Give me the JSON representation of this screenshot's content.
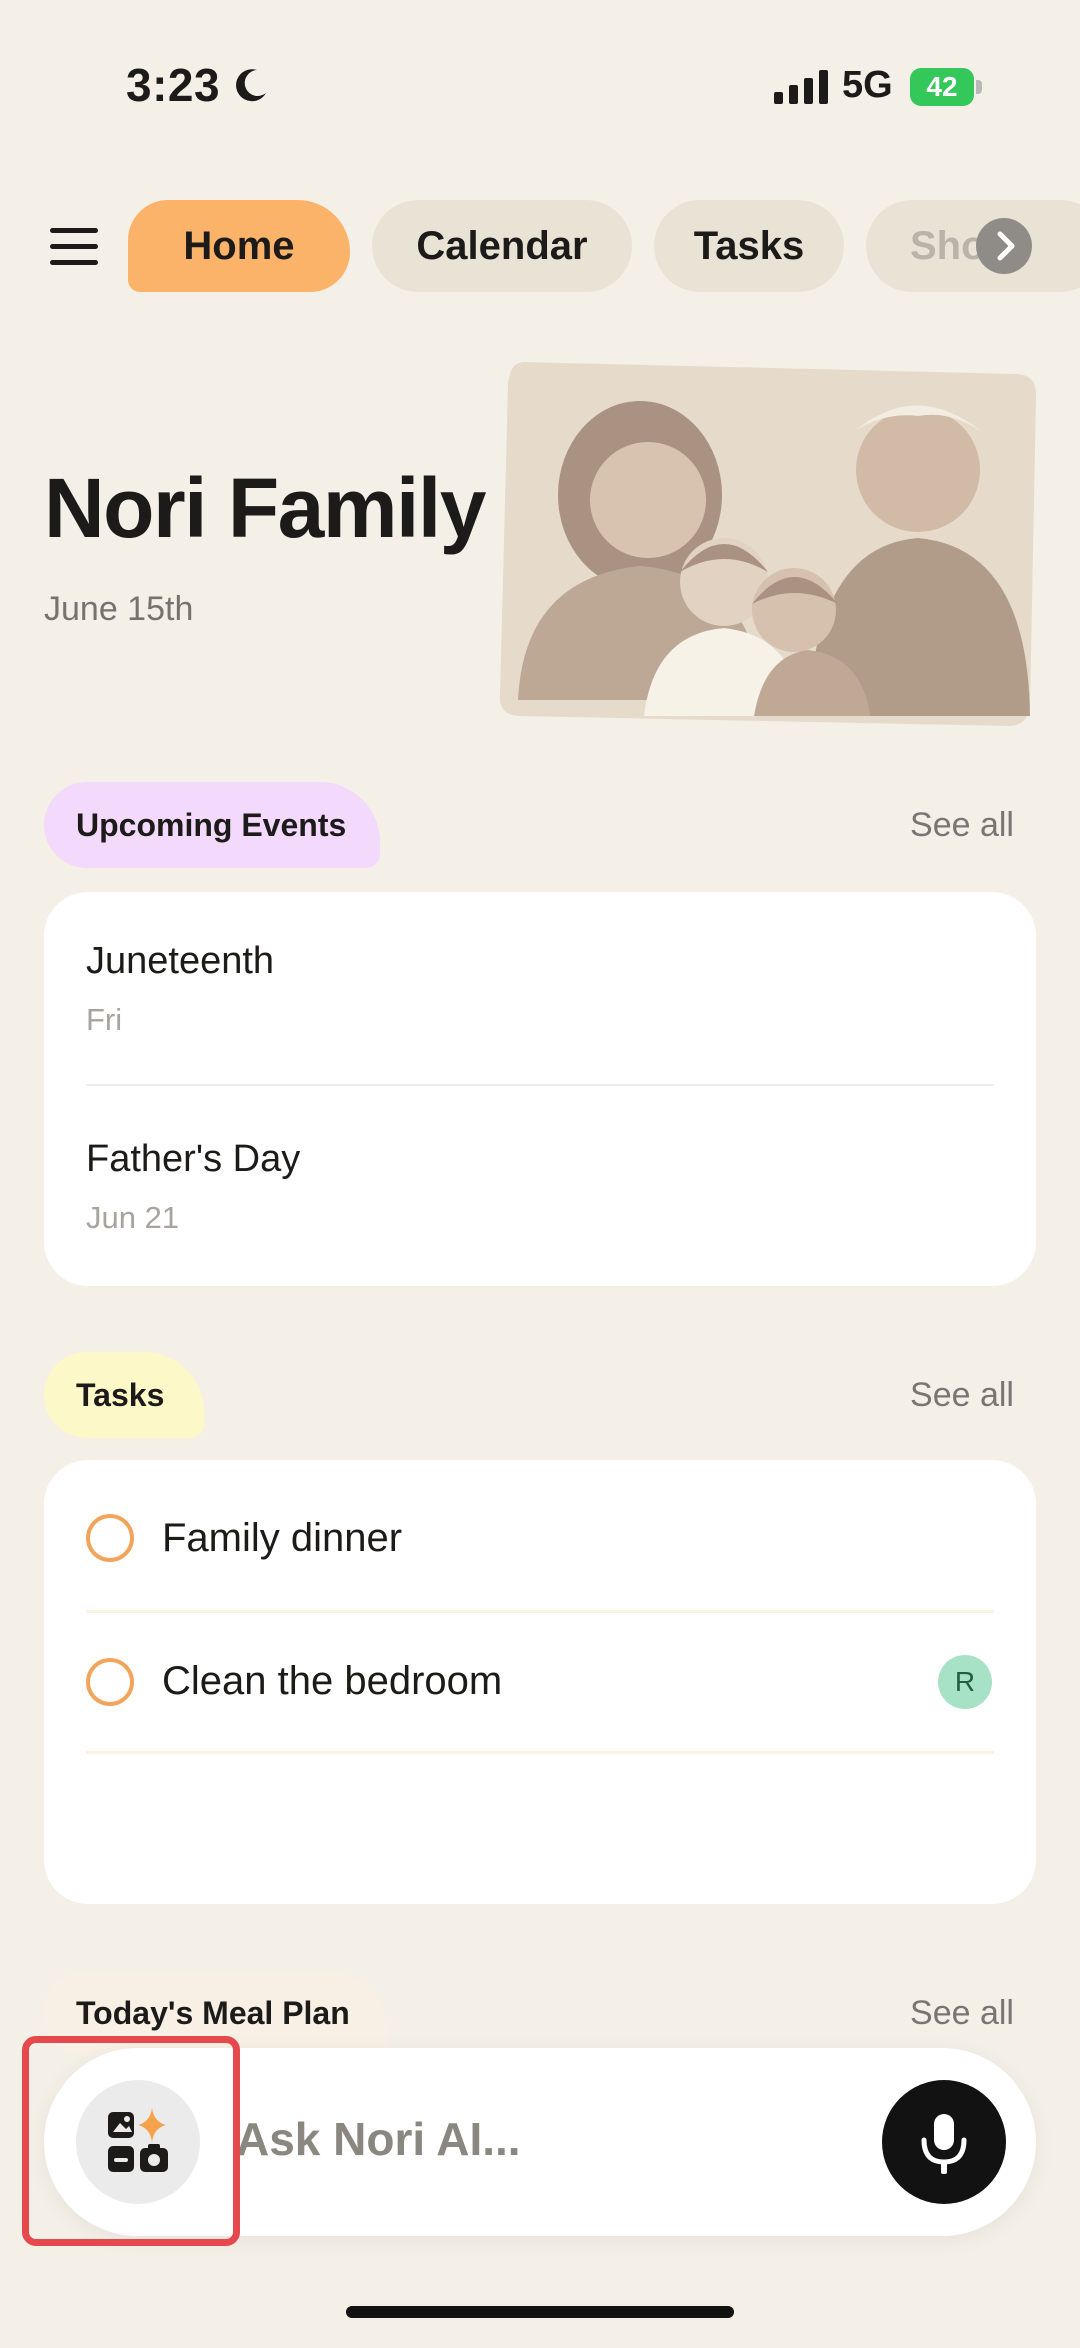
{
  "status_bar": {
    "time": "3:23",
    "network": "5G",
    "battery": "42",
    "battery_color": "#34c759",
    "icons": [
      "moon-icon",
      "signal-icon",
      "battery-charging-icon"
    ]
  },
  "nav": {
    "menu_icon": "hamburger-menu-icon",
    "tabs": [
      {
        "label": "Home",
        "active": true
      },
      {
        "label": "Calendar",
        "active": false
      },
      {
        "label": "Tasks",
        "active": false
      },
      {
        "label": "Sho",
        "active": false
      }
    ],
    "next_icon": "chevron-right-icon"
  },
  "hero": {
    "title": "Nori Family",
    "date": "June 15th",
    "illustration": "family-illustration"
  },
  "upcoming_events": {
    "label": "Upcoming Events",
    "see_all": "See all",
    "items": [
      {
        "title": "Juneteenth",
        "subtitle": "Fri"
      },
      {
        "title": "Father's Day",
        "subtitle": "Jun 21"
      }
    ]
  },
  "tasks": {
    "label": "Tasks",
    "see_all": "See all",
    "items": [
      {
        "title": "Family dinner",
        "assignee": ""
      },
      {
        "title": "Clean the bedroom",
        "assignee": "R"
      }
    ]
  },
  "meal_plan": {
    "label": "Today's Meal Plan",
    "see_all": "See all"
  },
  "composer": {
    "placeholder": "Ask Nori AI...",
    "widget_icon": "widgets-sparkle-icon",
    "mic_icon": "microphone-icon"
  },
  "colors": {
    "background": "#f4f0e8",
    "accent_orange": "#fbb36a",
    "events_pill": "#f3d9fb",
    "tasks_pill": "#fdf8c8",
    "meal_pill": "#f8efe5",
    "highlight": "#e5484d"
  }
}
